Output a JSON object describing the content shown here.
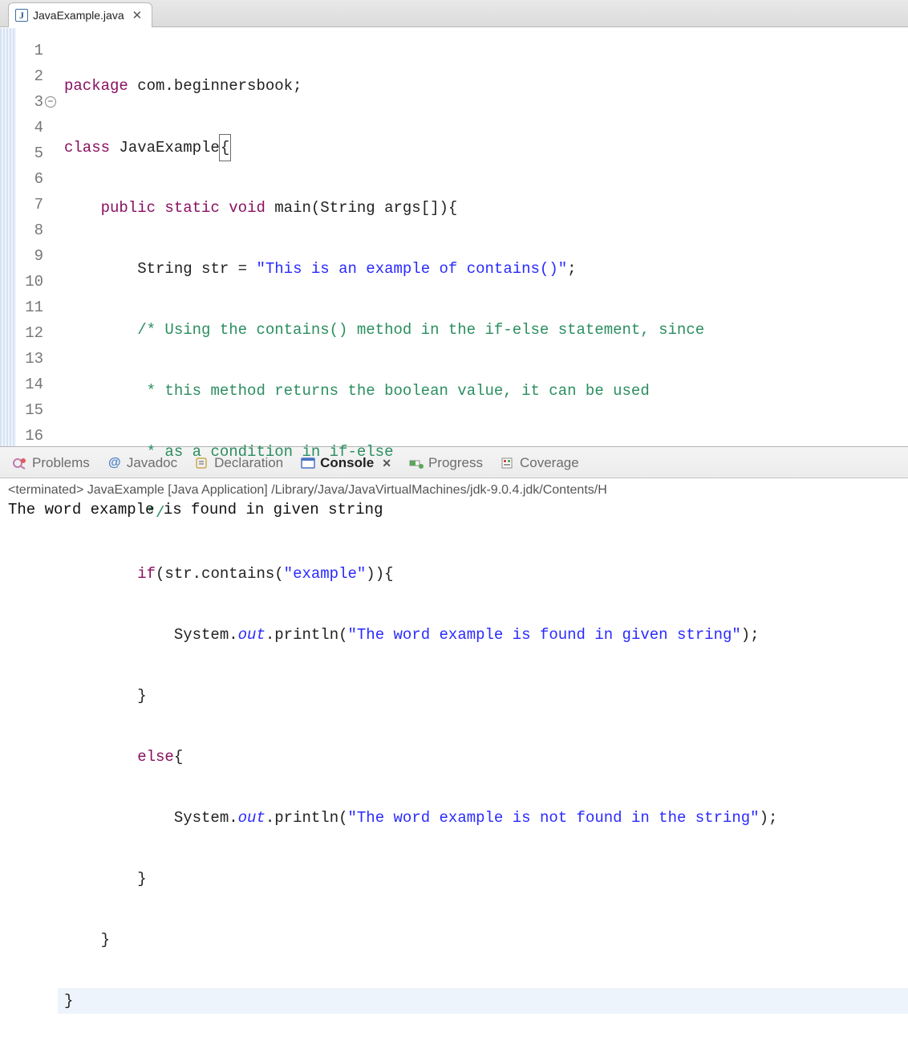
{
  "editor": {
    "tab": {
      "filename": "JavaExample.java",
      "icon_letter": "J"
    },
    "line_numbers": [
      "1",
      "2",
      "3",
      "4",
      "5",
      "6",
      "7",
      "8",
      "9",
      "10",
      "11",
      "12",
      "13",
      "14",
      "15",
      "16"
    ],
    "fold_at_line": "3",
    "highlight_line": 16,
    "code": {
      "l1": {
        "kw1": "package",
        "pkg": " com.beginnersbook;"
      },
      "l2": {
        "kw1": "class",
        "name": " JavaExample",
        "brace": "{"
      },
      "l3": {
        "indent": "    ",
        "kw1": "public",
        "kw2": " static",
        "kw3": " void",
        "rest": " main(String args[]){"
      },
      "l4": {
        "indent": "        ",
        "type": "String ",
        "var": "str = ",
        "str": "\"This is an example of contains()\"",
        "semi": ";"
      },
      "l5": {
        "indent": "        ",
        "com": "/* Using the contains() method in the if-else statement, since"
      },
      "l6": {
        "indent": "         ",
        "com": "* this method returns the boolean value, it can be used"
      },
      "l7": {
        "indent": "         ",
        "com": "* as a condition in if-else"
      },
      "l8": {
        "indent": "         ",
        "com": "*/"
      },
      "l9": {
        "indent": "        ",
        "kw1": "if",
        "rest1": "(str.contains(",
        "str": "\"example\"",
        "rest2": ")){"
      },
      "l10": {
        "indent": "            ",
        "sys": "System.",
        "out": "out",
        "print": ".println(",
        "str": "\"The word example is found in given string\"",
        "rest": ");"
      },
      "l11": {
        "indent": "        ",
        "brace": "}"
      },
      "l12": {
        "indent": "        ",
        "kw1": "else",
        "brace": "{"
      },
      "l13": {
        "indent": "            ",
        "sys": "System.",
        "out": "out",
        "print": ".println(",
        "str": "\"The word example is not found in the string\"",
        "rest": ");"
      },
      "l14": {
        "indent": "        ",
        "brace": "}"
      },
      "l15": {
        "indent": "    ",
        "brace": "}"
      },
      "l16": {
        "brace": "}"
      }
    }
  },
  "views": {
    "problems": "Problems",
    "javadoc": "Javadoc",
    "declaration": "Declaration",
    "console": "Console",
    "progress": "Progress",
    "coverage": "Coverage"
  },
  "console": {
    "status": "<terminated> JavaExample [Java Application] /Library/Java/JavaVirtualMachines/jdk-9.0.4.jdk/Contents/H",
    "output": "The word example is found in given string"
  }
}
